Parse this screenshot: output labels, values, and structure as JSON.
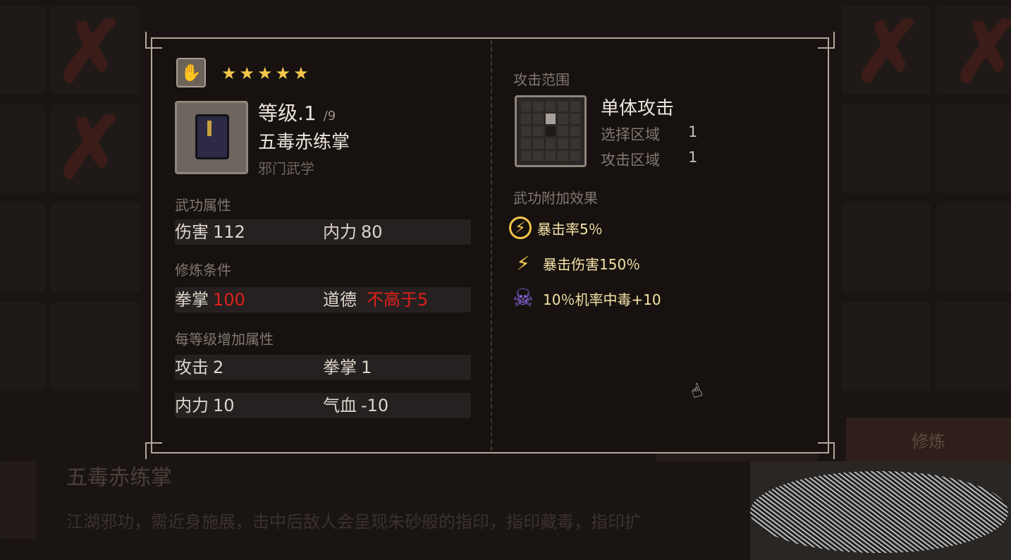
{
  "background": {
    "title": "五毒赤练掌",
    "description": "江湖邪功，需近身施展，击中后敌人会呈现朱砂般的指印，指印藏毒，指印扩",
    "buttons": [
      "修炼",
      "修炼"
    ]
  },
  "dialog": {
    "type_icon": "palm-icon",
    "stars": [
      "★",
      "★",
      "★",
      "★",
      "★"
    ],
    "level_label": "等级.1",
    "level_max": "/9",
    "skill_name": "五毒赤练掌",
    "category": "邪门武学",
    "attributes_label": "武功属性",
    "attributes": [
      {
        "name": "伤害",
        "value": "112"
      },
      {
        "name": "内力",
        "value": "80"
      }
    ],
    "requirements_label": "修炼条件",
    "requirements": [
      {
        "name": "拳掌",
        "value": "100"
      },
      {
        "name": "道德",
        "value": "不高于5"
      }
    ],
    "per_level_label": "每等级增加属性",
    "per_level": [
      {
        "name": "攻击",
        "value": "2"
      },
      {
        "name": "拳掌",
        "value": "1"
      },
      {
        "name": "内力",
        "value": "10"
      },
      {
        "name": "气血",
        "value": "-10"
      }
    ],
    "range_label": "攻击范围",
    "range_type": "单体攻击",
    "select_area_label": "选择区域",
    "select_area_value": "1",
    "attack_area_label": "攻击区域",
    "attack_area_value": "1",
    "effects_label": "武功附加效果",
    "effects": [
      {
        "icon": "crit-rate-icon",
        "text": "暴击率5％"
      },
      {
        "icon": "lightning-icon",
        "text": "暴击伤害150％"
      },
      {
        "icon": "poison-skull-icon",
        "text": "10％机率中毒+10"
      }
    ]
  },
  "colors": {
    "accent_gold": "#f3c64a",
    "requirement_red": "#e0201c",
    "poison_purple": "#8e6cf0"
  }
}
